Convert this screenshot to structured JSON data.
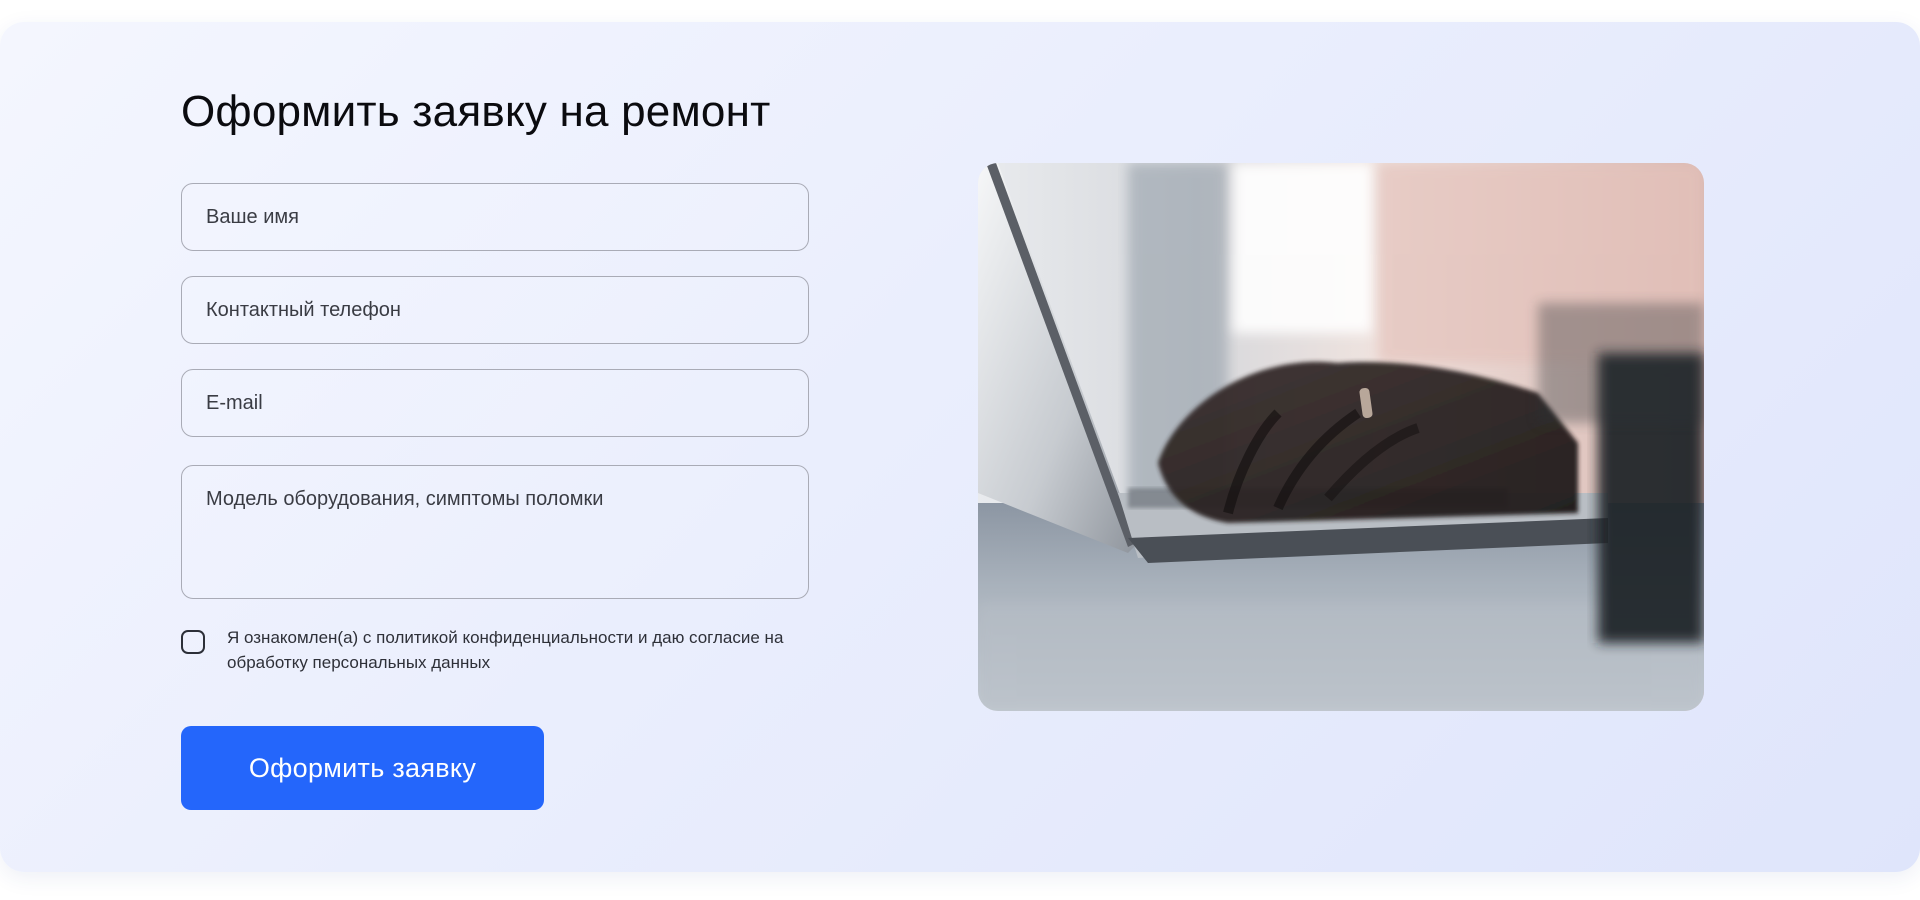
{
  "form": {
    "title": "Оформить заявку на ремонт",
    "name_placeholder": "Ваше имя",
    "phone_placeholder": "Контактный телефон",
    "email_placeholder": "E-mail",
    "details_placeholder": "Модель оборудования, симптомы поломки",
    "consent_checked": false,
    "consent_text": "Я ознакомлен(а) с политикой конфиденциальности и даю согласие на обработку персональных данных",
    "submit_label": "Оформить заявку"
  },
  "image": {
    "icon": "laptop-typing-photo"
  },
  "colors": {
    "accent": "#2466fb",
    "text": "#0b0b0f",
    "field_border": "#a9abb6",
    "background": "#eaeefd"
  }
}
